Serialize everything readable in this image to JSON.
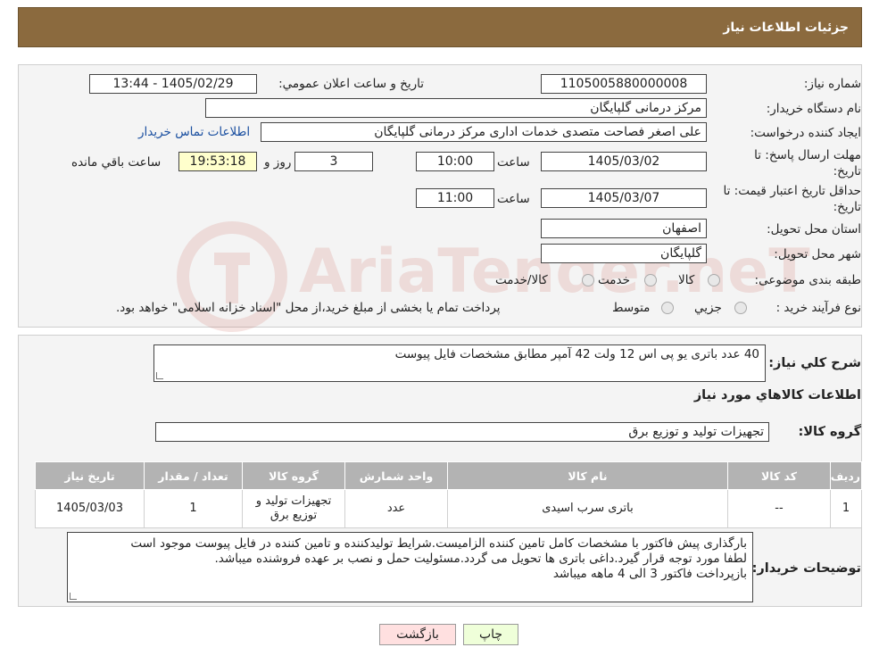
{
  "header": {
    "title": "جزئیات اطلاعات نیاز"
  },
  "form": {
    "need_number_label": "شماره نیاز:",
    "need_number": "1105005880000008",
    "announce_label": "تاریخ و ساعت اعلان عمومي:",
    "announce_value": "1405/02/29 - 13:44",
    "buyer_label": "نام دستگاه خريدار:",
    "buyer_value": "مرکز درمانی گلپایگان",
    "creator_label": "ايجاد کننده درخواست:",
    "creator_value": "علی اصغر فصاحت متصدی خدمات اداری مرکز درمانی گلپایگان",
    "contact_link": "اطلاعات تماس خريدار",
    "deadline_label_1": "مهلت ارسال پاسخ: تا",
    "deadline_label_2": "تاریخ:",
    "deadline_date": "1405/03/02",
    "time_label": "ساعت",
    "deadline_time": "10:00",
    "days_value": "3",
    "days_label": "روز و",
    "remaining_time": "19:53:18",
    "remaining_label": "ساعت باقي مانده",
    "validity_label_1": "حداقل تاريخ اعتبار قيمت: تا",
    "validity_label_2": "تاريخ:",
    "validity_date": "1405/03/07",
    "validity_time": "11:00",
    "province_label": "استان محل تحويل:",
    "province_value": "اصفهان",
    "city_label": "شهر محل تحويل:",
    "city_value": "گلپایگان",
    "category_label": "طبقه بندی موضوعی:",
    "category_options": [
      "کالا",
      "خدمت",
      "کالا/خدمت"
    ],
    "process_label": "نوع فرآيند خريد :",
    "process_options": [
      "جزيي",
      "متوسط"
    ],
    "process_note": "پرداخت تمام يا بخشی از مبلغ خريد،از محل \"اسناد خزانه اسلامی\" خواهد بود."
  },
  "description": {
    "label": "شرح کلي نياز:",
    "text": "40 عدد باتری یو پی اس 12 ولت 42 آمپر مطابق مشخصات فایل پیوست"
  },
  "goods": {
    "section_title": "اطلاعات کالاهاي مورد نياز",
    "group_label": "گروه کالا:",
    "group_value": "تجهیزات تولید و توزیع برق",
    "columns": [
      "رديف",
      "کد کالا",
      "نام کالا",
      "واحد شمارش",
      "گروه کالا",
      "تعداد / مقدار",
      "تاريخ نياز"
    ],
    "rows": [
      [
        "1",
        "--",
        "باتری سرب اسیدی",
        "عدد",
        "تجهیزات تولید و توزیع برق",
        "1",
        "1405/03/03"
      ]
    ]
  },
  "buyer_notes": {
    "label": "توضيحات خريدار:",
    "lines": [
      "بارگذاری پیش فاکتور با مشخصات کامل تامین کننده الزامیست.شرایط تولیدکننده و تامین کننده در فایل پیوست موجود است",
      "لطفا مورد توجه قرار گیرد.داغی باتری ها تحویل می گردد.مسئولیت حمل و نصب بر عهده فروشنده میباشد.",
      "بازپرداخت فاکتور 3 الی 4 ماهه میباشد"
    ]
  },
  "buttons": {
    "print": "چاپ",
    "back": "بازگشت"
  },
  "watermark": {
    "text": "AriaTender.neT"
  },
  "colors": {
    "header_bg": "#8b6a3e",
    "print_bg": "#efffd9",
    "back_bg": "#ffe0e0",
    "link": "#1a4fa0"
  }
}
